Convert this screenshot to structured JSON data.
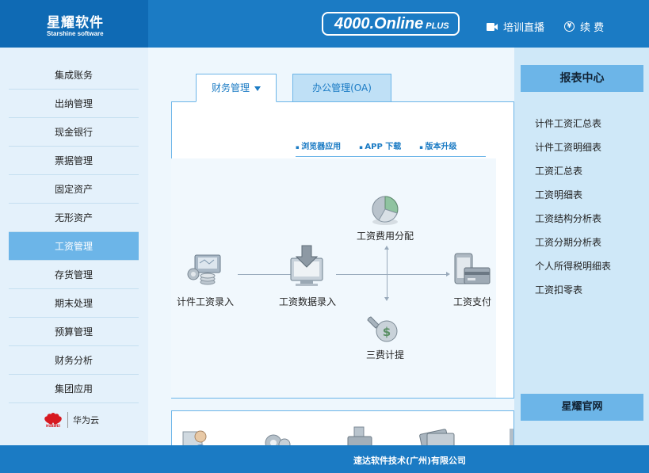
{
  "header": {
    "logo_cn": "星耀软件",
    "logo_en": "Starshine software",
    "badge_main": "4000.Online",
    "badge_sub": "PLUS",
    "training_label": "培训直播",
    "renew_label": "续 费",
    "renew_icon_glyph": "¥"
  },
  "sidebar": {
    "items": [
      {
        "label": "集成账务"
      },
      {
        "label": "出纳管理"
      },
      {
        "label": "现金银行"
      },
      {
        "label": "票据管理"
      },
      {
        "label": "固定资产"
      },
      {
        "label": "无形资产"
      },
      {
        "label": "工资管理"
      },
      {
        "label": "存货管理"
      },
      {
        "label": "期末处理"
      },
      {
        "label": "预算管理"
      },
      {
        "label": "财务分析"
      },
      {
        "label": "集团应用"
      }
    ],
    "active_index": 6,
    "partner_brand": "HUAWEI",
    "partner_name": "华为云"
  },
  "main": {
    "tabs": [
      {
        "label": "财务管理"
      },
      {
        "label": "办公管理(OA)"
      }
    ],
    "links": [
      {
        "label": "浏览器应用"
      },
      {
        "label": "APP 下载"
      },
      {
        "label": "版本升级"
      }
    ],
    "flow": {
      "piece_entry": "计件工资录入",
      "data_entry": "工资数据录入",
      "cost_alloc": "工资费用分配",
      "three_fee": "三费计提",
      "payment": "工资支付"
    }
  },
  "right": {
    "title": "报表中心",
    "reports": [
      {
        "label": "计件工资汇总表"
      },
      {
        "label": "计件工资明细表"
      },
      {
        "label": "工资汇总表"
      },
      {
        "label": "工资明细表"
      },
      {
        "label": "工资结构分析表"
      },
      {
        "label": "工资分期分析表"
      },
      {
        "label": "个人所得税明细表"
      },
      {
        "label": "工资扣零表"
      }
    ],
    "official_site": "星耀官网"
  },
  "footer": {
    "company": "速达软件技术(广州)有限公司"
  },
  "colors": {
    "primary": "#1b7bc4",
    "accent": "#6cb5e8",
    "sidebar_bg": "#e4f1fb",
    "right_bg": "#cfe8f8"
  }
}
